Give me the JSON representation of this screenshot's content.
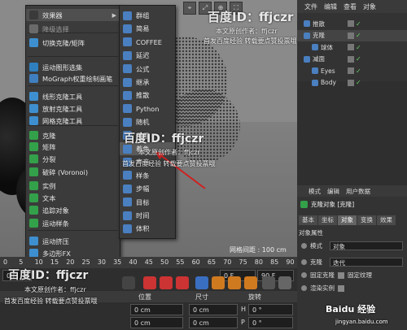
{
  "viewport": {
    "grid_readout": "网格间距 : 100 cm",
    "top_icons": [
      "⌖",
      "⤢",
      "⊕",
      "⛶"
    ]
  },
  "menu_main": {
    "items": [
      {
        "label": "效果器",
        "submenu": true,
        "icon_color": "#3a3a3a",
        "highlight": true
      },
      {
        "label": "降级选择",
        "dim": true,
        "icon_color": "#6a6a6a"
      },
      {
        "label": "切换克隆/矩阵",
        "icon_color": "#3e8fcf"
      },
      {
        "label": "运动图形选集",
        "icon_color": "#2f7fbf"
      },
      {
        "label": "MoGraph权重绘制画笔",
        "icon_color": "#3f7fbf"
      },
      {
        "label": "线形克隆工具",
        "icon_color": "#3e8fcf"
      },
      {
        "label": "放射克隆工具",
        "icon_color": "#3e8fcf"
      },
      {
        "label": "网格克隆工具",
        "icon_color": "#3e8fcf"
      },
      {
        "label": "克隆",
        "icon_color": "#33a04a"
      },
      {
        "label": "矩阵",
        "icon_color": "#33a04a"
      },
      {
        "label": "分裂",
        "icon_color": "#33a04a"
      },
      {
        "label": "破碎 (Voronoi)",
        "icon_color": "#33a04a"
      },
      {
        "label": "实例",
        "icon_color": "#33a04a"
      },
      {
        "label": "文本",
        "icon_color": "#33a04a"
      },
      {
        "label": "追踪对象",
        "icon_color": "#33a04a"
      },
      {
        "label": "运动样条",
        "icon_color": "#33a04a"
      },
      {
        "label": "运动挤压",
        "icon_color": "#3e8fcf"
      },
      {
        "label": "多边形FX",
        "icon_color": "#3e8fcf"
      }
    ]
  },
  "menu_sub": {
    "items": [
      {
        "label": "群组",
        "icon_color": "#4a7fc0"
      },
      {
        "label": "简易",
        "icon_color": "#4a7fc0"
      },
      {
        "label": "COFFEE",
        "icon_color": "#4a7fc0"
      },
      {
        "label": "延迟",
        "icon_color": "#4a7fc0"
      },
      {
        "label": "公式",
        "icon_color": "#4a7fc0"
      },
      {
        "label": "继承",
        "icon_color": "#4a7fc0"
      },
      {
        "label": "推散",
        "icon_color": "#4a7fc0"
      },
      {
        "label": "Python",
        "icon_color": "#4a7fc0"
      },
      {
        "label": "随机",
        "icon_color": "#4a7fc0"
      },
      {
        "label": "重置",
        "icon_color": "#4a7fc0"
      },
      {
        "label": "着色",
        "icon_color": "#4a7fc0",
        "highlight": true
      },
      {
        "label": "声音",
        "icon_color": "#4a7fc0"
      },
      {
        "label": "样条",
        "icon_color": "#4a7fc0"
      },
      {
        "label": "步幅",
        "icon_color": "#4a7fc0"
      },
      {
        "label": "目标",
        "icon_color": "#4a7fc0"
      },
      {
        "label": "时间",
        "icon_color": "#4a7fc0"
      },
      {
        "label": "体积",
        "icon_color": "#4a7fc0"
      }
    ]
  },
  "object_manager": {
    "menu": [
      "文件",
      "编辑",
      "查看",
      "对象"
    ],
    "objects": [
      {
        "label": "推散",
        "indent": 0
      },
      {
        "label": "克隆",
        "indent": 0,
        "selected": true
      },
      {
        "label": "球体",
        "indent": 1
      },
      {
        "label": "减面",
        "indent": 0
      },
      {
        "label": "Eyes",
        "indent": 1
      },
      {
        "label": "Body",
        "indent": 1
      }
    ]
  },
  "attribute_manager": {
    "menu": [
      "模式",
      "编辑",
      "用户数据"
    ],
    "title": "克隆对象 [克隆]",
    "tabs": [
      {
        "label": "基本",
        "active": false
      },
      {
        "label": "坐标",
        "active": false
      },
      {
        "label": "对象",
        "active": true
      },
      {
        "label": "变换",
        "active": false
      },
      {
        "label": "效果",
        "active": false
      }
    ],
    "section": "对象属性",
    "mode_label": "模式",
    "mode_value": "对象",
    "clone_label": "克隆",
    "clone_value": "迭代",
    "fixed_clone": "固定克隆",
    "fixed_texture": "固定纹理",
    "render_instance": "渲染实例"
  },
  "timeline": {
    "ticks": [
      "0",
      "5",
      "10",
      "15",
      "20",
      "25",
      "30",
      "35",
      "40",
      "45",
      "50",
      "55",
      "60",
      "65",
      "70",
      "75",
      "80",
      "85",
      "90"
    ],
    "frame_field": "0 F",
    "end_field": "90 F",
    "current": "0 F"
  },
  "coordinates": {
    "headers": [
      "位置",
      "尺寸",
      "旋转"
    ],
    "rows": [
      {
        "pos": "0 cm",
        "size": "0 cm",
        "rot_label": "H",
        "rot": "0 °"
      },
      {
        "pos": "0 cm",
        "size": "0 cm",
        "rot_label": "P",
        "rot": "0 °"
      }
    ]
  },
  "overlays": {
    "wm_main": "百度ID：ffjczr",
    "wm_line1": "本文原创作者：ffjczr",
    "wm_line2": "首发百度经验 转载要点赞投票哦",
    "wm_mid": "百度ID：ffjczr",
    "wm_bottom": "百度ID：ffjczr",
    "jingyan": "jingyan.baidu.com",
    "jingyan_brand": "Baidu 经验"
  },
  "colors": {
    "arrow": "#d02020",
    "highlight": "#4f4f4f",
    "accent_blue": "#2f7fbf",
    "check_green": "#66cc66"
  }
}
